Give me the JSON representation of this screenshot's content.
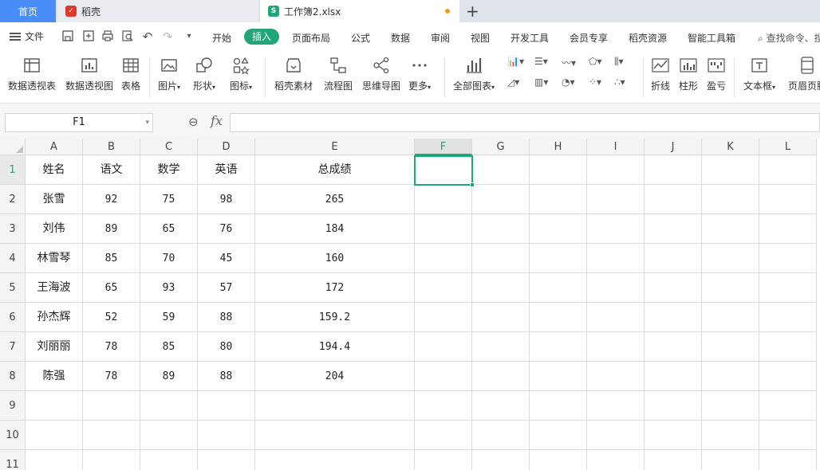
{
  "tabs": {
    "home": "首页",
    "daoke": "稻壳",
    "workbook": "工作簿2.xlsx"
  },
  "menu": {
    "file": "文件",
    "items": [
      "开始",
      "插入",
      "页面布局",
      "公式",
      "数据",
      "审阅",
      "视图",
      "开发工具",
      "会员专享",
      "稻壳资源",
      "智能工具箱"
    ],
    "active": "插入",
    "search": "查找命令、搜"
  },
  "ribbon": {
    "pivot_table": "数据透视表",
    "pivot_chart": "数据透视图",
    "table": "表格",
    "picture": "图片",
    "shape": "形状",
    "icon": "图标",
    "material": "稻壳素材",
    "flowchart": "流程图",
    "mindmap": "思维导图",
    "more": "更多",
    "all_charts": "全部图表",
    "sparkline_line": "折线",
    "sparkline_column": "柱形",
    "sparkline_winloss": "盈亏",
    "textbox": "文本框",
    "header_footer": "页眉页脚"
  },
  "formula_bar": {
    "cell_ref": "F1",
    "fx": "fx",
    "value": ""
  },
  "sheet": {
    "columns": [
      "A",
      "B",
      "C",
      "D",
      "E",
      "F",
      "G",
      "H",
      "I",
      "J",
      "K",
      "L"
    ],
    "selected_column": "F",
    "selected_row": "1",
    "rows": [
      "1",
      "2",
      "3",
      "4",
      "5",
      "6",
      "7",
      "8",
      "9",
      "10",
      "11"
    ],
    "header": [
      "姓名",
      "语文",
      "数学",
      "英语",
      "总成绩"
    ],
    "data": [
      [
        "张雪",
        "92",
        "75",
        "98",
        "265"
      ],
      [
        "刘伟",
        "89",
        "65",
        "76",
        "184"
      ],
      [
        "林雪琴",
        "85",
        "70",
        "45",
        "160"
      ],
      [
        "王海波",
        "65",
        "93",
        "57",
        "172"
      ],
      [
        "孙杰辉",
        "52",
        "59",
        "88",
        "159.2"
      ],
      [
        "刘丽丽",
        "78",
        "85",
        "80",
        "194.4"
      ],
      [
        "陈强",
        "78",
        "89",
        "88",
        "204"
      ]
    ]
  },
  "colors": {
    "accent": "#1fa67a",
    "home_tab": "#4a8df8",
    "modified_dot": "#f39c12"
  }
}
